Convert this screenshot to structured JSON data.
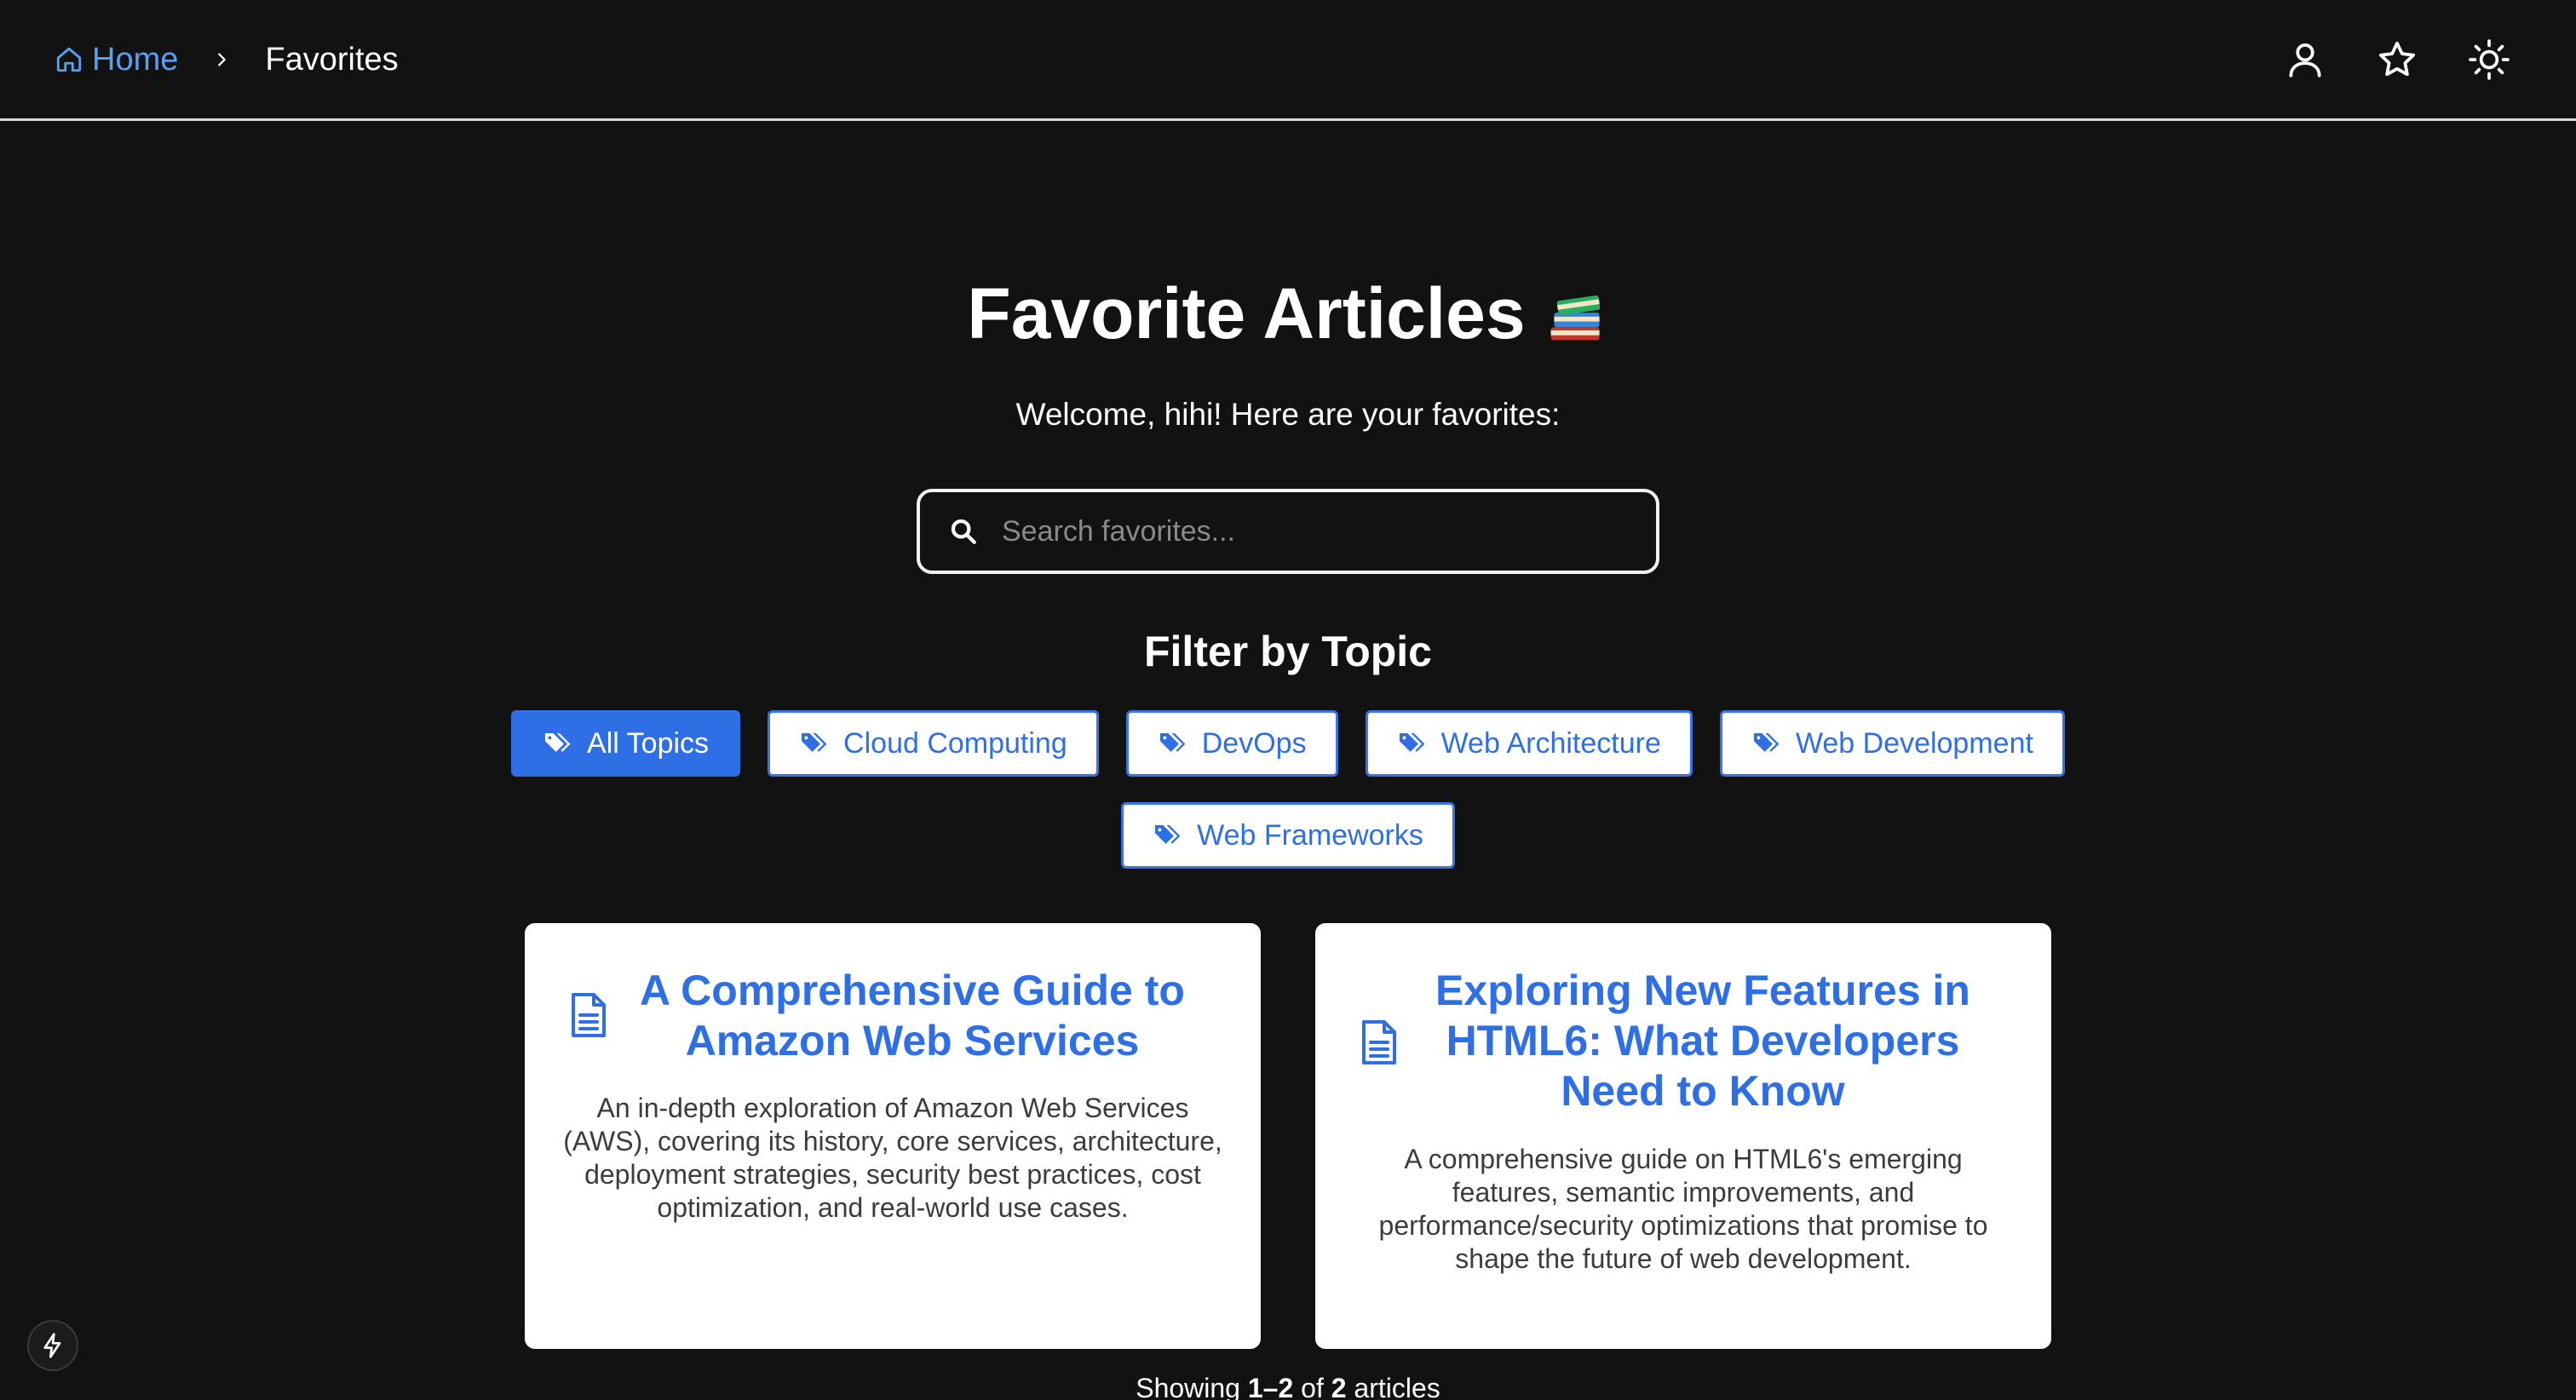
{
  "breadcrumb": {
    "home_label": "Home",
    "current_label": "Favorites"
  },
  "topbar": {
    "icons": [
      "user-icon",
      "star-icon",
      "sun-icon"
    ]
  },
  "header": {
    "title": "Favorite Articles",
    "title_icon": "books-icon",
    "welcome": "Welcome, hihi! Here are your favorites:"
  },
  "search": {
    "placeholder": "Search favorites...",
    "value": ""
  },
  "filters": {
    "heading": "Filter by Topic",
    "chips": [
      {
        "label": "All Topics",
        "active": true
      },
      {
        "label": "Cloud Computing",
        "active": false
      },
      {
        "label": "DevOps",
        "active": false
      },
      {
        "label": "Web Architecture",
        "active": false
      },
      {
        "label": "Web Development",
        "active": false
      },
      {
        "label": "Web Frameworks",
        "active": false
      }
    ]
  },
  "articles": [
    {
      "title": "A Comprehensive Guide to Amazon Web Services",
      "description": "An in-depth exploration of Amazon Web Services (AWS), covering its history, core services, architecture, deployment strategies, security best practices, cost optimization, and real-world use cases."
    },
    {
      "title": "Exploring New Features in HTML6: What Developers Need to Know",
      "description": "A comprehensive guide on HTML6's emerging features, semantic improvements, and performance/security optimizations that promise to shape the future of web development."
    }
  ],
  "pagination": {
    "prefix": "Showing",
    "range": "1–2",
    "of_word": "of",
    "total": "2",
    "suffix": "articles"
  },
  "colors": {
    "background": "#121212",
    "accent": "#2f6fe6",
    "link": "#5aa0f2",
    "card": "#ffffff"
  }
}
